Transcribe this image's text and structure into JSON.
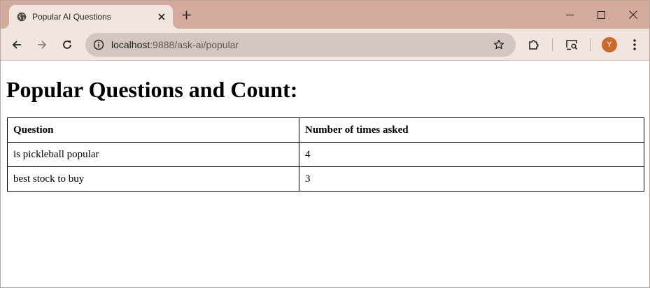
{
  "browser": {
    "tab": {
      "title": "Popular AI Questions"
    },
    "address_bar": {
      "host": "localhost",
      "rest": ":9888/ask-ai/popular"
    },
    "profile": {
      "initial": "Y",
      "color": "#c9692c"
    },
    "theme": {
      "tabstrip": "#d3aa9c",
      "toolbar": "#f2e4df",
      "omnibox": "#d4c5c0"
    }
  },
  "page": {
    "title": "Popular Questions and Count:",
    "table": {
      "headers": [
        "Question",
        "Number of times asked"
      ],
      "rows": [
        [
          "is pickleball popular",
          "4"
        ],
        [
          "best stock to buy",
          "3"
        ]
      ]
    }
  },
  "icons": [
    "globe-icon",
    "close-icon",
    "plus-icon",
    "minimize-icon",
    "maximize-icon",
    "window-close-icon",
    "back-arrow-icon",
    "forward-arrow-icon",
    "reload-icon",
    "site-info-icon",
    "star-icon",
    "extensions-icon",
    "cast-search-icon",
    "more-vertical-icon"
  ]
}
